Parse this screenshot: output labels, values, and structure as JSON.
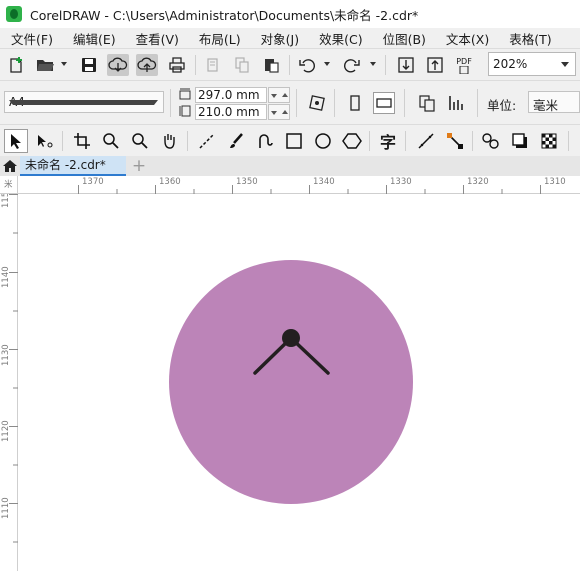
{
  "window": {
    "title": "CorelDRAW - C:\\Users\\Administrator\\Documents\\未命名 -2.cdr*"
  },
  "menu": [
    "文件(F)",
    "编辑(E)",
    "查看(V)",
    "布局(L)",
    "对象(J)",
    "效果(C)",
    "位图(B)",
    "文本(X)",
    "表格(T)"
  ],
  "toolbar": {
    "zoom_value": "202%",
    "pdf_label": "PDF"
  },
  "property_bar": {
    "page_size": "A4",
    "width": "297.0 mm",
    "height": "210.0 mm",
    "units_label": "单位:",
    "units_value": "毫米"
  },
  "tabs": {
    "document_tab": "未命名 -2.cdr*",
    "add_tab": "+"
  },
  "rulers": {
    "horizontal": [
      "1370",
      "1360",
      "1350",
      "1340",
      "1330",
      "1320",
      "1310"
    ],
    "vertical": [
      "1140",
      "1130",
      "1120",
      "1110"
    ],
    "corner_h": "米",
    "corner_v": "115"
  },
  "toolbox": {
    "text_tool_glyph": "字"
  },
  "colors": {
    "circle_fill": "#bc84b8",
    "hands": "#231f20",
    "accent": "#2e7bcf"
  }
}
